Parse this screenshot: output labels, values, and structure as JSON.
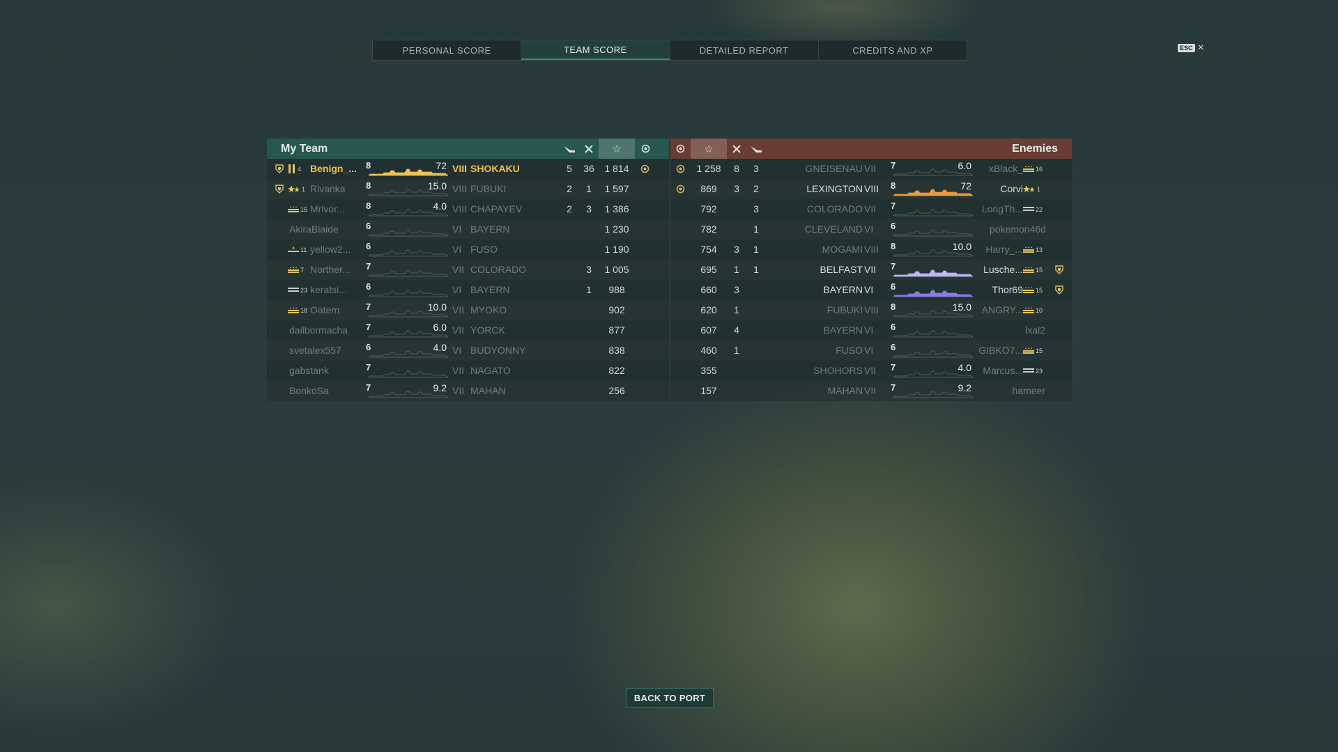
{
  "tabs": [
    "PERSONAL SCORE",
    "TEAM SCORE",
    "DETAILED REPORT",
    "CREDITS AND XP"
  ],
  "active_tab": "TEAM SCORE",
  "esc": {
    "key": "ESC",
    "close": "×"
  },
  "my_team": {
    "title": "My Team",
    "rows": [
      {
        "badge": "rank-shield",
        "rankIcon": "bars",
        "rankNum": "4",
        "name": "Benign_...",
        "tier": "8",
        "hp": "72",
        "shipTier": "VIII",
        "ship": "SHOKAKU",
        "kills": "5",
        "planes": "36",
        "score": "1 814",
        "medal": "yes",
        "style": "hl",
        "bar": "gold"
      },
      {
        "badge": "rank-shield",
        "rankIcon": "stars",
        "rankNum": "1",
        "name": "Rivanka",
        "tier": "8",
        "hp": "15.0",
        "shipTier": "VIII",
        "ship": "FUBUKI",
        "kills": "2",
        "planes": "1",
        "score": "1 597",
        "medal": "",
        "style": "dim",
        "bar": ""
      },
      {
        "badge": "",
        "rankIcon": "stripes",
        "rankNum": "15",
        "name": "Mrlvor...",
        "tier": "8",
        "hp": "4.0",
        "shipTier": "VIII",
        "ship": "CHAPAYEV",
        "kills": "2",
        "planes": "3",
        "score": "1 386",
        "medal": "",
        "style": "dim",
        "bar": ""
      },
      {
        "badge": "",
        "rankIcon": "",
        "rankNum": "",
        "name": "AkiraBlaide",
        "tier": "6",
        "hp": "",
        "shipTier": "VI",
        "ship": "BAYERN",
        "kills": "",
        "planes": "",
        "score": "1 230",
        "medal": "",
        "style": "dim",
        "bar": ""
      },
      {
        "badge": "",
        "rankIcon": "stripes1",
        "rankNum": "11",
        "name": "yellow2...",
        "tier": "6",
        "hp": "",
        "shipTier": "VI",
        "ship": "FUSO",
        "kills": "",
        "planes": "",
        "score": "1 190",
        "medal": "",
        "style": "dim",
        "bar": ""
      },
      {
        "badge": "",
        "rankIcon": "stripes",
        "rankNum": "7",
        "name": "Norther...",
        "tier": "7",
        "hp": "",
        "shipTier": "VII",
        "ship": "COLORADO",
        "kills": "",
        "planes": "3",
        "score": "1 005",
        "medal": "",
        "style": "dim",
        "bar": ""
      },
      {
        "badge": "",
        "rankIcon": "bar",
        "rankNum": "23",
        "name": "keratsi...",
        "tier": "6",
        "hp": "",
        "shipTier": "VI",
        "ship": "BAYERN",
        "kills": "",
        "planes": "1",
        "score": "988",
        "medal": "",
        "style": "dim",
        "bar": ""
      },
      {
        "badge": "",
        "rankIcon": "stripes",
        "rankNum": "18",
        "name": "Oatem",
        "tier": "7",
        "hp": "10.0",
        "shipTier": "VII",
        "ship": "MYOKO",
        "kills": "",
        "planes": "",
        "score": "902",
        "medal": "",
        "style": "dim",
        "bar": ""
      },
      {
        "badge": "",
        "rankIcon": "",
        "rankNum": "",
        "name": "dailbormacha",
        "tier": "7",
        "hp": "6.0",
        "shipTier": "VII",
        "ship": "YORCK",
        "kills": "",
        "planes": "",
        "score": "877",
        "medal": "",
        "style": "dim",
        "bar": ""
      },
      {
        "badge": "",
        "rankIcon": "",
        "rankNum": "",
        "name": "svetalex557",
        "tier": "6",
        "hp": "4.0",
        "shipTier": "VI",
        "ship": "BUDYONNY",
        "kills": "",
        "planes": "",
        "score": "838",
        "medal": "",
        "style": "dim",
        "bar": ""
      },
      {
        "badge": "",
        "rankIcon": "",
        "rankNum": "",
        "name": "gabstank",
        "tier": "7",
        "hp": "",
        "shipTier": "VII",
        "ship": "NAGATO",
        "kills": "",
        "planes": "",
        "score": "822",
        "medal": "",
        "style": "dim",
        "bar": ""
      },
      {
        "badge": "",
        "rankIcon": "",
        "rankNum": "",
        "name": "BonkoSa",
        "tier": "7",
        "hp": "9.2",
        "shipTier": "VII",
        "ship": "MAHAN",
        "kills": "",
        "planes": "",
        "score": "256",
        "medal": "",
        "style": "dim",
        "bar": ""
      }
    ]
  },
  "enemies": {
    "title": "Enemies",
    "rows": [
      {
        "medal": "yes",
        "score": "1 258",
        "planes": "8",
        "kills": "3",
        "ship": "GNEISENAU",
        "shipTier": "VII",
        "tier": "7",
        "hp": "6.0",
        "name": "xBlack_",
        "rankIcon": "stripes",
        "rankNum": "16",
        "badge": "",
        "style": "dim",
        "bar": ""
      },
      {
        "medal": "yes",
        "score": "869",
        "planes": "3",
        "kills": "2",
        "ship": "LEXINGTON",
        "shipTier": "VIII",
        "tier": "8",
        "hp": "72",
        "name": "Corvi",
        "rankIcon": "stars",
        "rankNum": "1",
        "badge": "",
        "style": "norm",
        "bar": "orange"
      },
      {
        "medal": "",
        "score": "792",
        "planes": "",
        "kills": "3",
        "ship": "COLORADO",
        "shipTier": "VII",
        "tier": "7",
        "hp": "",
        "name": "LongTh...",
        "rankIcon": "bar",
        "rankNum": "22",
        "badge": "",
        "style": "dim",
        "bar": ""
      },
      {
        "medal": "",
        "score": "782",
        "planes": "",
        "kills": "1",
        "ship": "CLEVELAND",
        "shipTier": "VI",
        "tier": "6",
        "hp": "",
        "name": "pokemon46d",
        "rankIcon": "",
        "rankNum": "",
        "badge": "",
        "style": "dim",
        "bar": ""
      },
      {
        "medal": "",
        "score": "754",
        "planes": "3",
        "kills": "1",
        "ship": "MOGAMI",
        "shipTier": "VIII",
        "tier": "8",
        "hp": "10.0",
        "name": "Harry_...",
        "rankIcon": "stripes",
        "rankNum": "13",
        "badge": "",
        "style": "dim",
        "bar": ""
      },
      {
        "medal": "",
        "score": "695",
        "planes": "1",
        "kills": "1",
        "ship": "BELFAST",
        "shipTier": "VII",
        "tier": "7",
        "hp": "",
        "name": "Lusche...",
        "rankIcon": "stripes",
        "rankNum": "15",
        "badge": "rank-shield",
        "style": "norm",
        "bar": "lavender"
      },
      {
        "medal": "",
        "score": "660",
        "planes": "3",
        "kills": "",
        "ship": "BAYERN",
        "shipTier": "VI",
        "tier": "6",
        "hp": "",
        "name": "Thor69",
        "rankIcon": "stripes",
        "rankNum": "15",
        "badge": "rank-shield",
        "style": "norm",
        "bar": "purple"
      },
      {
        "medal": "",
        "score": "620",
        "planes": "1",
        "kills": "",
        "ship": "FUBUKI",
        "shipTier": "VIII",
        "tier": "8",
        "hp": "15.0",
        "name": "ANGRY...",
        "rankIcon": "stripes",
        "rankNum": "10",
        "badge": "",
        "style": "dim",
        "bar": ""
      },
      {
        "medal": "",
        "score": "607",
        "planes": "4",
        "kills": "",
        "ship": "BAYERN",
        "shipTier": "VI",
        "tier": "6",
        "hp": "",
        "name": "lxal2",
        "rankIcon": "",
        "rankNum": "",
        "badge": "",
        "style": "dim",
        "bar": ""
      },
      {
        "medal": "",
        "score": "460",
        "planes": "1",
        "kills": "",
        "ship": "FUSO",
        "shipTier": "VI",
        "tier": "6",
        "hp": "",
        "name": "GIBKO7...",
        "rankIcon": "stripes",
        "rankNum": "15",
        "badge": "",
        "style": "dim",
        "bar": ""
      },
      {
        "medal": "",
        "score": "355",
        "planes": "",
        "kills": "",
        "ship": "SHOHORS",
        "shipTier": "VII",
        "tier": "7",
        "hp": "4.0",
        "name": "Marcus...",
        "rankIcon": "bar",
        "rankNum": "23",
        "badge": "",
        "style": "dim",
        "bar": ""
      },
      {
        "medal": "",
        "score": "157",
        "planes": "",
        "kills": "",
        "ship": "MAHAN",
        "shipTier": "VII",
        "tier": "7",
        "hp": "9.2",
        "name": "hameer",
        "rankIcon": "",
        "rankNum": "",
        "badge": "",
        "style": "dim",
        "bar": ""
      }
    ]
  },
  "colors": {
    "my_team_header": "#27574f",
    "enemy_header": "#6a3c33",
    "highlight": "#f0c24d"
  },
  "back_button": "BACK TO PORT"
}
